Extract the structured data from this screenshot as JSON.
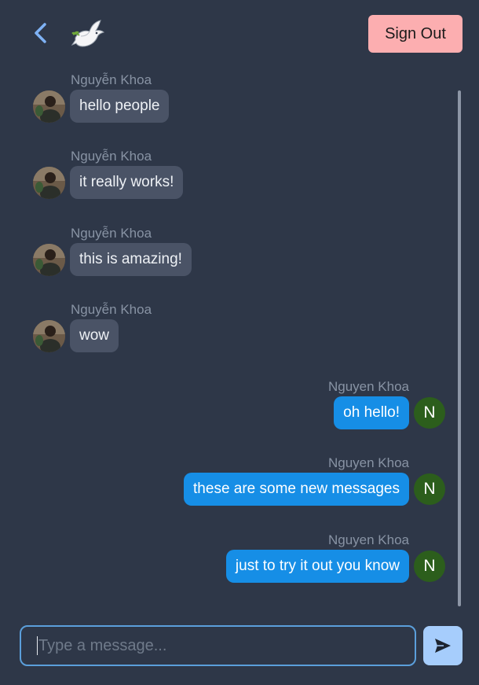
{
  "header": {
    "back_icon": "chevron-left-icon",
    "logo_icon": "dove-icon",
    "sign_out_label": "Sign Out"
  },
  "messages": [
    {
      "direction": "incoming",
      "sender": "Nguyễn Khoa",
      "text": "hello people",
      "avatar": "photo"
    },
    {
      "direction": "incoming",
      "sender": "Nguyễn Khoa",
      "text": "it really works!",
      "avatar": "photo"
    },
    {
      "direction": "incoming",
      "sender": "Nguyễn Khoa",
      "text": "this is amazing!",
      "avatar": "photo"
    },
    {
      "direction": "incoming",
      "sender": "Nguyễn Khoa",
      "text": "wow",
      "avatar": "photo"
    },
    {
      "direction": "outgoing",
      "sender": "Nguyen Khoa",
      "text": "oh hello!",
      "avatar_letter": "N"
    },
    {
      "direction": "outgoing",
      "sender": "Nguyen Khoa",
      "text": "these are some new messages",
      "avatar_letter": "N"
    },
    {
      "direction": "outgoing",
      "sender": "Nguyen Khoa",
      "text": "just to try it out you know",
      "avatar_letter": "N"
    }
  ],
  "composer": {
    "placeholder": "Type a message...",
    "value": "",
    "send_icon": "send-icon"
  },
  "colors": {
    "background": "#2e3748",
    "incoming_bubble": "#4a5366",
    "outgoing_bubble": "#168ee6",
    "sign_out_button": "#fcaeb0",
    "send_button": "#a6cdfc",
    "input_border": "#5b9fdb",
    "letter_avatar": "#2c5e1c"
  }
}
